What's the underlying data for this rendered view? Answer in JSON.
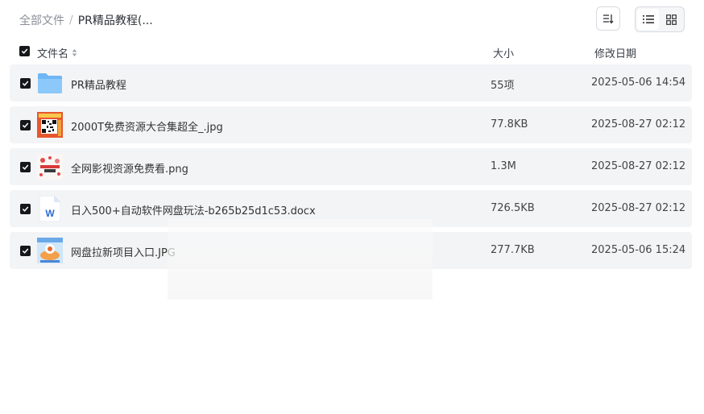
{
  "breadcrumb": {
    "root": "全部文件",
    "separator": "/",
    "current": "PR精品教程(..."
  },
  "toolbar": {
    "sort_icon": "sort-icon",
    "list_view_icon": "list-view-icon",
    "grid_view_icon": "grid-view-icon",
    "active_view": "list"
  },
  "header": {
    "name": "文件名",
    "size": "大小",
    "date": "修改日期"
  },
  "colors": {
    "checkbox": "#16171a",
    "row_bg": "#f3f4f6",
    "folder": "#5aa9f0",
    "word_blue": "#2b6cd4"
  },
  "files": [
    {
      "name": "PR精品教程",
      "size": "55项",
      "date": "2025-05-06 14:54",
      "icon": "folder-icon"
    },
    {
      "name": "2000T免费资源大合集超全_.jpg",
      "size": "77.8KB",
      "date": "2025-08-27 02:12",
      "icon": "image-thumbnail-icon"
    },
    {
      "name": "全网影视资源免费看.png",
      "size": "1.3M",
      "date": "2025-08-27 02:12",
      "icon": "image-thumbnail-icon"
    },
    {
      "name": "日入500+自动软件网盘玩法-b265b25d1c53.docx",
      "size": "726.5KB",
      "date": "2025-08-27 02:12",
      "icon": "word-doc-icon"
    },
    {
      "name": "网盘拉新项目入口.JPG",
      "size": "277.7KB",
      "date": "2025-05-06 15:24",
      "icon": "image-thumbnail-icon"
    }
  ]
}
